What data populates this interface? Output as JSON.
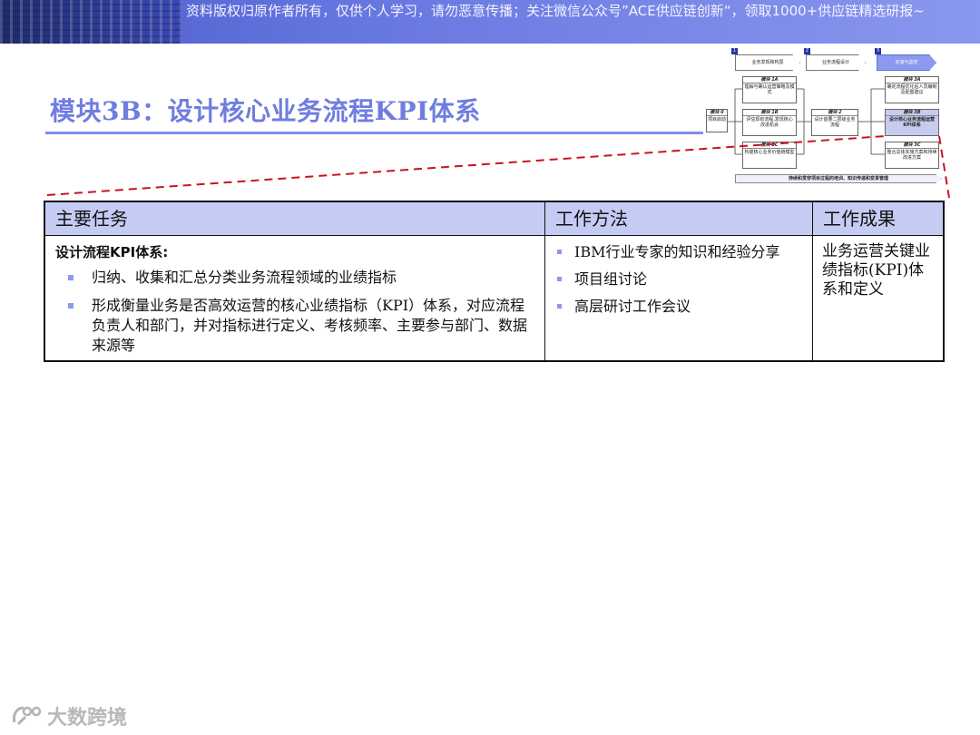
{
  "banner": {
    "text": "资料版权归原作者所有，仅供个人学习，请勿恶意传播；关注微信公众号”ACE供应链创新“，领取1000+供应链精选研报~"
  },
  "title": "模块3B：设计核心业务流程KPI体系",
  "diagram": {
    "phases": [
      {
        "number": "1",
        "label": "业务发现和构思"
      },
      {
        "number": "2",
        "label": "业务流程设计"
      },
      {
        "number": "3",
        "label": "实施与监控"
      }
    ],
    "modules": {
      "m0": {
        "header": "模块 0",
        "body": "项目启动"
      },
      "m1a": {
        "header": "模块 1A",
        "body": "理解与确认运营策略及模式"
      },
      "m1b": {
        "header": "模块 1B",
        "body": "评估现有流程,发现核心改进机会"
      },
      "m1c": {
        "header": "模块 1C",
        "body": "构建核心业务价值链模型"
      },
      "m2": {
        "header": "模块 2",
        "body": "设计首要二层级业务流程"
      },
      "m3a": {
        "header": "模块 3A",
        "body": "确定流程优化后人员编制及配置建议"
      },
      "m3b": {
        "header": "模块 3B",
        "body": "设计核心业务流程运营KPI体系"
      },
      "m3c": {
        "header": "模块 3C",
        "body": "整合总体实施方案和持续改进方案"
      }
    },
    "bottom_bar": "持续和贯穿项目过程的培训、知识传递和变革管理"
  },
  "table": {
    "headers": {
      "tasks": "主要任务",
      "methods": "工作方法",
      "results": "工作成果"
    },
    "tasks": {
      "lead": "设计流程KPI体系:",
      "items": [
        "归纳、收集和汇总分类业务流程领域的业绩指标",
        "形成衡量业务是否高效运营的核心业绩指标（KPI）体系，对应流程负责人和部门，并对指标进行定义、考核频率、主要参与部门、数据来源等"
      ]
    },
    "methods": [
      "IBM行业专家的知识和经验分享",
      "项目组讨论",
      "高层研讨工作会议"
    ],
    "results": "业务运营关键业绩指标(KPI)体系和定义"
  },
  "watermark": {
    "text": "大数跨境"
  },
  "colors": {
    "accent": "#6f7de0",
    "header_fill": "#c6cbf4",
    "callout": "#cc1122"
  }
}
